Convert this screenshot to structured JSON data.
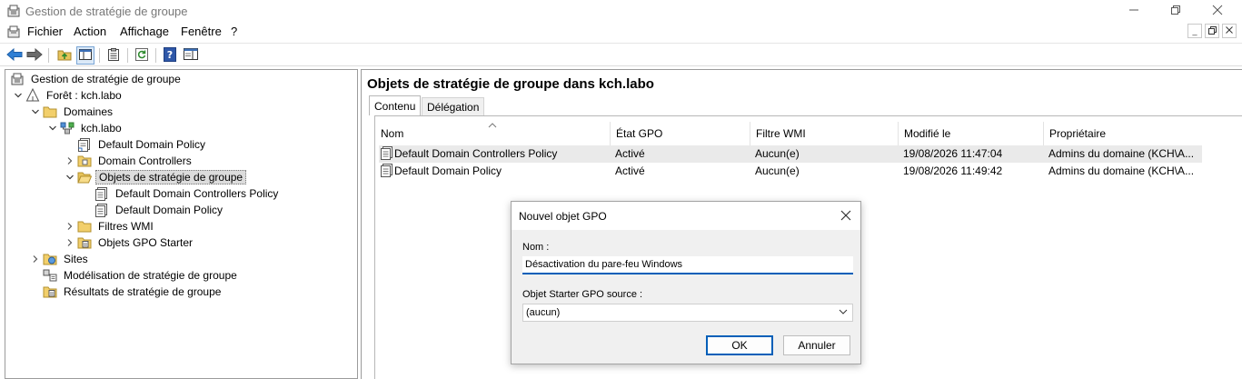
{
  "window": {
    "title": "Gestion de stratégie de groupe",
    "icon": "gpmc-icon"
  },
  "menu": [
    "Fichier",
    "Action",
    "Affichage",
    "Fenêtre",
    "?"
  ],
  "toolbar": {
    "buttons": [
      "back-arrow-icon",
      "forward-arrow-icon",
      "up-folder-icon",
      "show-hide-tree-icon",
      "properties-icon",
      "refresh-icon",
      "help-icon",
      "console-view-icon"
    ]
  },
  "tree": {
    "items": [
      {
        "label": "Gestion de stratégie de groupe",
        "depth": 0,
        "expander": "",
        "icon": "gpmc-icon",
        "selected": false
      },
      {
        "label": "Forêt : kch.labo",
        "depth": 1,
        "expander": "down",
        "icon": "forest-icon",
        "selected": false
      },
      {
        "label": "Domaines",
        "depth": 2,
        "expander": "down",
        "icon": "folder-icon",
        "selected": false
      },
      {
        "label": "kch.labo",
        "depth": 3,
        "expander": "down",
        "icon": "domain-icon",
        "selected": false
      },
      {
        "label": "Default Domain Policy",
        "depth": 4,
        "expander": "",
        "icon": "gpo-link-icon",
        "selected": false
      },
      {
        "label": "Domain Controllers",
        "depth": 4,
        "expander": "right",
        "icon": "ou-icon",
        "selected": false
      },
      {
        "label": "Objets de stratégie de groupe",
        "depth": 4,
        "expander": "down",
        "icon": "folder-open-icon",
        "selected": true
      },
      {
        "label": "Default Domain Controllers Policy",
        "depth": 5,
        "expander": "",
        "icon": "gpo-icon",
        "selected": false
      },
      {
        "label": "Default Domain Policy",
        "depth": 5,
        "expander": "",
        "icon": "gpo-icon",
        "selected": false
      },
      {
        "label": "Filtres WMI",
        "depth": 4,
        "expander": "right",
        "icon": "folder-icon",
        "selected": false
      },
      {
        "label": "Objets GPO Starter",
        "depth": 4,
        "expander": "right",
        "icon": "starter-gpo-icon",
        "selected": false
      },
      {
        "label": "Sites",
        "depth": 2,
        "expander": "right",
        "icon": "sites-icon",
        "selected": false
      },
      {
        "label": "Modélisation de stratégie de groupe",
        "depth": 2,
        "expander": "",
        "icon": "modeling-icon",
        "selected": false
      },
      {
        "label": "Résultats de stratégie de groupe",
        "depth": 2,
        "expander": "",
        "icon": "results-icon",
        "selected": false
      }
    ]
  },
  "main": {
    "header": "Objets de stratégie de groupe dans kch.labo",
    "tabs": [
      {
        "label": "Contenu",
        "active": true
      },
      {
        "label": "Délégation",
        "active": false
      }
    ],
    "columns": [
      "Nom",
      "État GPO",
      "Filtre WMI",
      "Modifié le",
      "Propriétaire"
    ],
    "rows": [
      {
        "nom": "Default Domain Controllers Policy",
        "etat": "Activé",
        "filtre": "Aucun(e)",
        "modifie": "19/08/2026 11:47:04",
        "proprietaire": "Admins du domaine (KCH\\A..."
      },
      {
        "nom": "Default Domain Policy",
        "etat": "Activé",
        "filtre": "Aucun(e)",
        "modifie": "19/08/2026 11:49:42",
        "proprietaire": "Admins du domaine (KCH\\A..."
      }
    ]
  },
  "dialog": {
    "title": "Nouvel objet GPO",
    "name_label": "Nom :",
    "name_value": "Désactivation du pare-feu Windows",
    "starter_label": "Objet Starter GPO source :",
    "starter_value": "(aucun)",
    "ok_label": "OK",
    "cancel_label": "Annuler"
  },
  "colors": {
    "accent": "#005fb8",
    "selection": "#dcdcdc",
    "row_highlight": "#eaeaea"
  }
}
